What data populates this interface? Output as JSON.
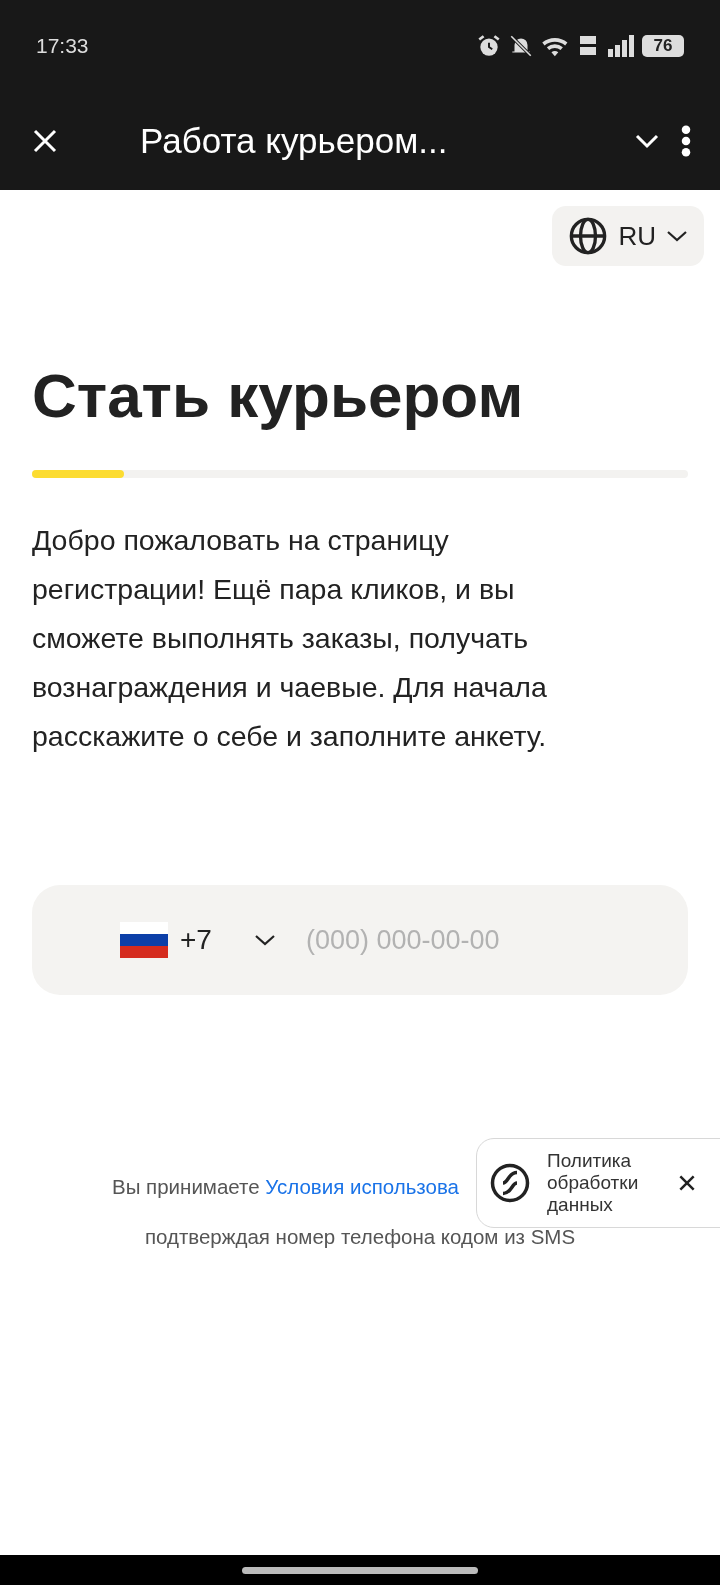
{
  "status_bar": {
    "time": "17:33",
    "battery": "76"
  },
  "app_bar": {
    "title": "Работа курьером..."
  },
  "language": {
    "label": "RU"
  },
  "heading": "Стать курьером",
  "progress": {
    "level": 0.14
  },
  "intro": "Добро пожаловать на страницу регистрации! Ещё пара кликов, и вы сможете выполнять заказы, получать вознаграждения и чаевые. Для начала расскажите о себе и заполните анкету.",
  "phone": {
    "code": "+7",
    "placeholder": "(000) 000-00-00"
  },
  "terms": {
    "prefix": "Вы принимаете",
    "link": "Условия использова",
    "line_2": "подтверждая номер телефона кодом из SMS"
  },
  "popup": {
    "text": "Политика обработки данных"
  }
}
